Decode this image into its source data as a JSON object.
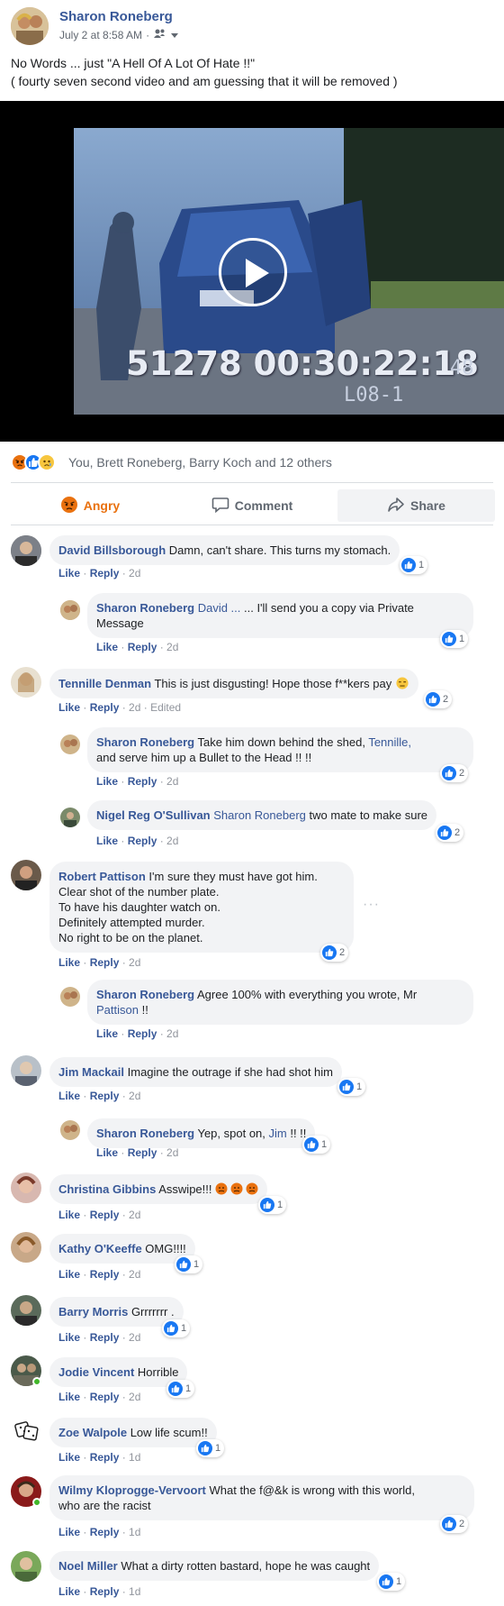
{
  "post": {
    "author": "Sharon Roneberg",
    "timestamp": "July 2 at 8:58 AM",
    "separator": "·",
    "text_line1": "No Words ... just \"A Hell Of A Lot Of Hate !!\"",
    "text_line2": "( fourty seven second video and am guessing that it will be removed )"
  },
  "video": {
    "stamp": "51278 00:30:22:18",
    "small1": "48",
    "small2": "L08-1"
  },
  "reactions": {
    "icons": [
      "angry-emoji-icon",
      "like-icon",
      "sad-emoji-icon"
    ],
    "summary": "You, Brett Roneberg, Barry Koch and 12 others"
  },
  "actions": {
    "angry": "Angry",
    "comment": "Comment",
    "share": "Share"
  },
  "colors": {
    "link": "#385898",
    "angry": "#e9710f",
    "like": "#1877f2",
    "bubble": "#f2f3f5"
  },
  "comments": [
    {
      "name": "David Billsborough",
      "text": "Damn, can't share. This turns my stomach.",
      "like": "Like",
      "reply": "Reply",
      "time": "2d",
      "count": "1"
    },
    {
      "name": "Sharon Roneberg",
      "mention": "David ...",
      "text": " ... I'll send you a copy via Private",
      "text2": "Message",
      "like": "Like",
      "reply": "Reply",
      "time": "2d",
      "count": "1"
    },
    {
      "name": "Tennille Denman",
      "text": "This is just disgusting! Hope those f**kers pay",
      "like": "Like",
      "reply": "Reply",
      "time": "2d",
      "edited": "Edited",
      "count": "2"
    },
    {
      "name": "Sharon Roneberg",
      "text": "Take him down behind the shed,",
      "mention": "Tennille,",
      "text2": "and serve him up a Bullet to the Head !! !!",
      "like": "Like",
      "reply": "Reply",
      "time": "2d",
      "count": "2"
    },
    {
      "name": "Nigel Reg O'Sullivan",
      "mention": "Sharon Roneberg",
      "text": " two mate to make sure",
      "like": "Like",
      "reply": "Reply",
      "time": "2d",
      "count": "2"
    },
    {
      "name": "Robert Pattison",
      "text": "I'm sure they must have got him.",
      "lines": [
        "Clear shot of the number plate.",
        "To have his daughter watch on.",
        "Definitely attempted murder.",
        "No right to be on the planet."
      ],
      "like": "Like",
      "reply": "Reply",
      "time": "2d",
      "count": "2"
    },
    {
      "name": "Sharon Roneberg",
      "text": "Agree 100% with everything you wrote, Mr",
      "mention": "Pattison",
      "text2": " !!",
      "like": "Like",
      "reply": "Reply",
      "time": "2d"
    },
    {
      "name": "Jim Mackail",
      "text": "Imagine the outrage if she had shot him",
      "like": "Like",
      "reply": "Reply",
      "time": "2d",
      "count": "1"
    },
    {
      "name": "Sharon Roneberg",
      "text": "Yep, spot on,",
      "mention": "Jim",
      "text2": " !! !!",
      "like": "Like",
      "reply": "Reply",
      "time": "2d",
      "count": "1"
    },
    {
      "name": "Christina Gibbins",
      "text": "Asswipe!!!",
      "like": "Like",
      "reply": "Reply",
      "time": "2d",
      "count": "1"
    },
    {
      "name": "Kathy O'Keeffe",
      "text": "OMG!!!!",
      "like": "Like",
      "reply": "Reply",
      "time": "2d",
      "count": "1"
    },
    {
      "name": "Barry Morris",
      "text": "Grrrrrrr .",
      "like": "Like",
      "reply": "Reply",
      "time": "2d",
      "count": "1"
    },
    {
      "name": "Jodie Vincent",
      "text": "Horrible",
      "like": "Like",
      "reply": "Reply",
      "time": "2d",
      "count": "1"
    },
    {
      "name": "Zoe Walpole",
      "text": "Low life scum!!",
      "like": "Like",
      "reply": "Reply",
      "time": "1d",
      "count": "1"
    },
    {
      "name": "Wilmy Kloprogge-Vervoort",
      "text": "What the f@&k is wrong with this world,",
      "text2": "who are the racist",
      "like": "Like",
      "reply": "Reply",
      "time": "1d",
      "count": "2"
    },
    {
      "name": "Noel Miller",
      "text": "What a dirty rotten bastard, hope he was caught",
      "like": "Like",
      "reply": "Reply",
      "time": "1d",
      "count": "1"
    }
  ]
}
